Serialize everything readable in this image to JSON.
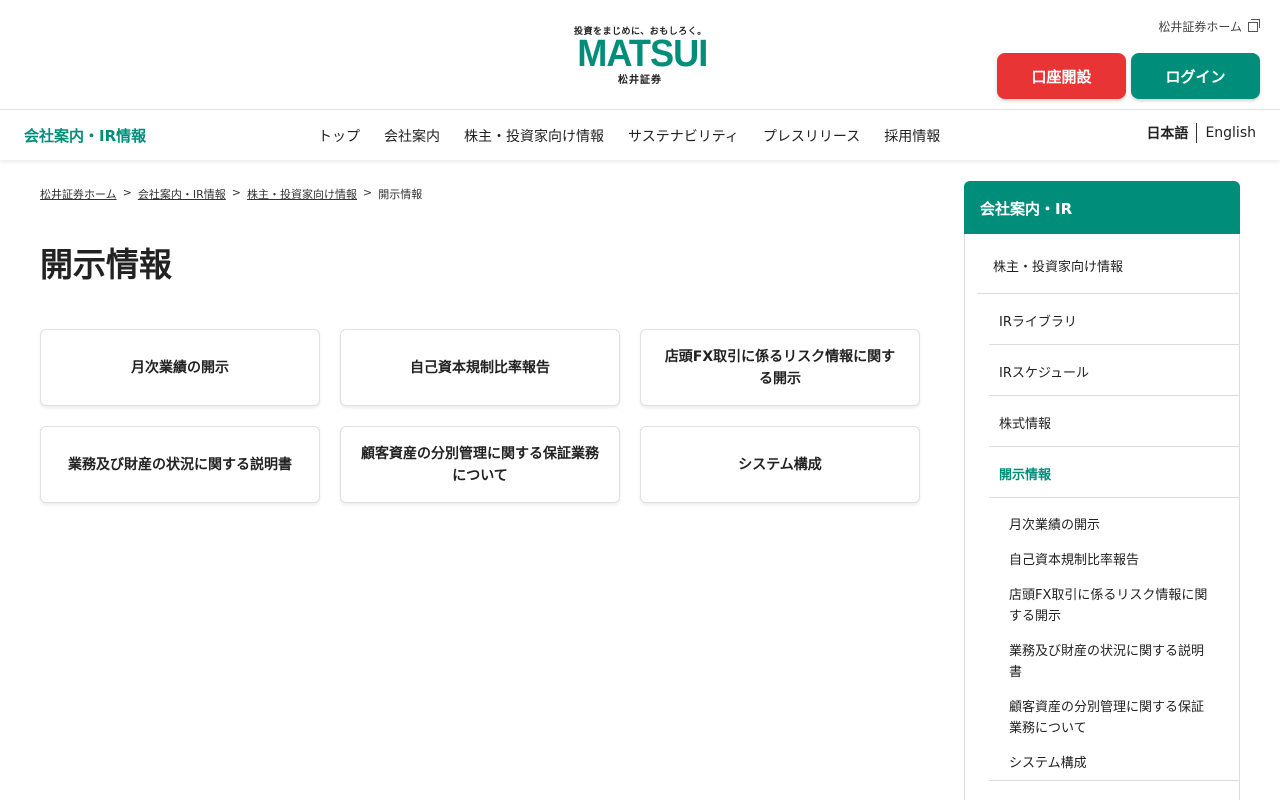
{
  "header": {
    "tagline": "投資をまじめに、おもしろく。",
    "logo_text": "MATSUI",
    "logo_sub": "松井証券",
    "home_link": "松井証券ホーム",
    "open_account": "口座開設",
    "login": "ログイン",
    "colors": {
      "brand": "#008e7a",
      "open_account": "#e83434"
    }
  },
  "nav": {
    "title": "会社案内・IR情報",
    "items": [
      "トップ",
      "会社案内",
      "株主・投資家向け情報",
      "サステナビリティ",
      "プレスリリース",
      "採用情報"
    ],
    "lang_ja": "日本語",
    "lang_en": "English"
  },
  "breadcrumb": [
    "松井証券ホーム",
    "会社案内・IR情報",
    "株主・投資家向け情報",
    "開示情報"
  ],
  "breadcrumb_sep": ">",
  "page_title": "開示情報",
  "cards": [
    "月次業績の開示",
    "自己資本規制比率報告",
    "店頭FX取引に係るリスク情報に関する開示",
    "業務及び財産の状況に関する説明書",
    "顧客資産の分別管理に関する保証業務について",
    "システム構成"
  ],
  "sidebar": {
    "heading": "会社案内・IR",
    "level1": "株主・投資家向け情報",
    "level2": [
      "IRライブラリ",
      "IRスケジュール",
      "株式情報",
      "開示情報"
    ],
    "level3": [
      "月次業績の開示",
      "自己資本規制比率報告",
      "店頭FX取引に係るリスク情報に関する開示",
      "業務及び財産の状況に関する説明書",
      "顧客資産の分別管理に関する保証業務について",
      "システム構成"
    ]
  }
}
